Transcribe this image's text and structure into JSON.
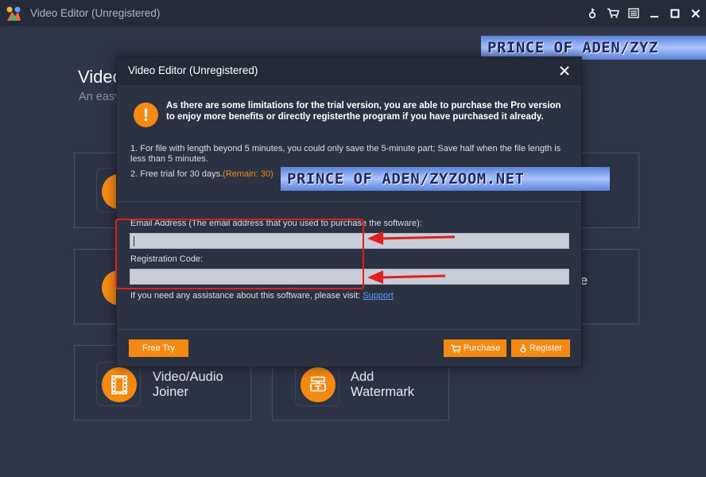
{
  "window": {
    "title": "Video Editor (Unregistered)",
    "icons": [
      "key-icon",
      "cart-icon",
      "menu-icon",
      "minimize-icon",
      "maximize-icon",
      "close-icon"
    ]
  },
  "background": {
    "heading": "Video",
    "subtitle": "An easy",
    "tiles": [
      {
        "label_line1": "Video/Audio",
        "label_line2": "Joiner",
        "icon": "film-strip-icon"
      },
      {
        "label_line1": "Add",
        "label_line2": "Watermark",
        "icon": "watermark-icon"
      }
    ],
    "partial_letter": "e"
  },
  "watermark": {
    "top": "PRINCE OF ADEN/ZYZ",
    "middle": "PRINCE OF ADEN/ZYZOOM.NET"
  },
  "dialog": {
    "title": "Video Editor (Unregistered)",
    "warning": "As there are some limitations for the trial version, you are able to purchase the Pro version to enjoy more benefits or directly registerthe program if you have purchased it already.",
    "note1": "1. For file with length beyond 5 minutes, you could only save the 5-minute part; Save half when the file length is less than 5 minutes.",
    "note2": "2. Free trial for 30 days.",
    "remain": "(Remain: 30)",
    "email_label": "Email Address (The email address that you used to purchase the software):",
    "email_value": "",
    "code_label": "Registration Code:",
    "code_value": "",
    "help_text": "If you need any assistance about this software, please visit:",
    "support_link": "Support",
    "free_try": "Free Try",
    "purchase": "Purchase",
    "register": "Register"
  },
  "colors": {
    "accent": "#f58a13",
    "annotation": "#e21f1f",
    "link": "#5aa0ff"
  }
}
